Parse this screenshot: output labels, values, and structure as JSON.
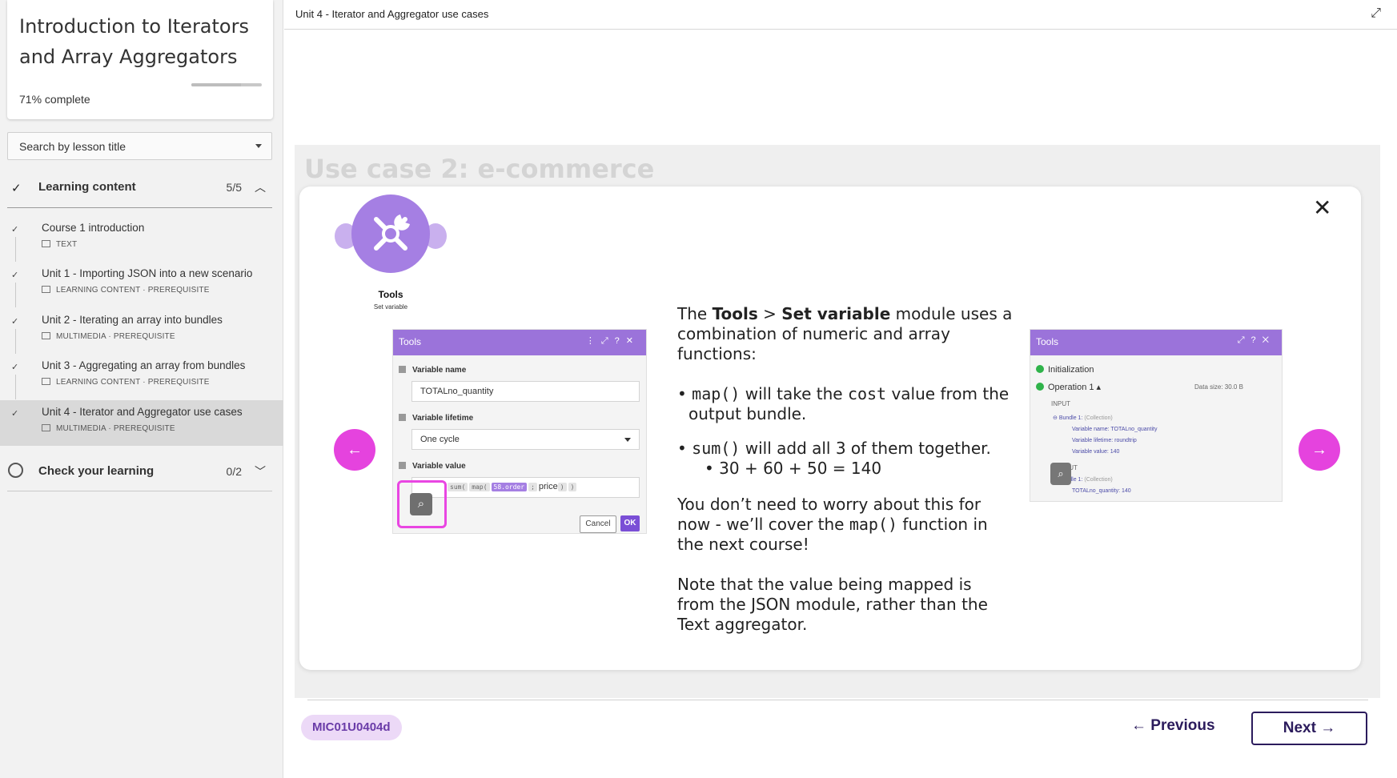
{
  "sidebar": {
    "course_title": "Introduction to Iterators and Array Aggregators",
    "progress_percent": 71,
    "progress_text": "71% complete",
    "search_placeholder": "Search by lesson title",
    "sections": [
      {
        "label": "Learning content",
        "count": "5/5",
        "expanded": true
      },
      {
        "label": "Check your learning",
        "count": "0/2",
        "expanded": false
      }
    ],
    "lessons": [
      {
        "title": "Course 1 introduction",
        "meta": "TEXT"
      },
      {
        "title": "Unit 1 - Importing JSON into a new scenario",
        "meta": "LEARNING CONTENT · PREREQUISITE"
      },
      {
        "title": "Unit 2 - Iterating an array into bundles",
        "meta": "MULTIMEDIA · PREREQUISITE"
      },
      {
        "title": "Unit 3 - Aggregating an array from bundles",
        "meta": "LEARNING CONTENT · PREREQUISITE"
      },
      {
        "title": "Unit 4 - Iterator and Aggregator use cases",
        "meta": "MULTIMEDIA · PREREQUISITE",
        "active": true
      }
    ]
  },
  "topbar": {
    "unit_title": "Unit 4 - Iterator and Aggregator use cases"
  },
  "slide": {
    "heading": "Use case 2: e-commerce",
    "module": {
      "name": "Tools",
      "subtitle": "Set variable"
    },
    "left_dialog": {
      "title": "Tools",
      "field1_label": "Variable name",
      "field1_value": "TOTALno_quantity",
      "field2_label": "Variable lifetime",
      "field2_value": "One cycle",
      "field3_label": "Variable value",
      "formula": {
        "fn1": "sum(",
        "fn2": "map(",
        "ref": "58.order",
        "sep": "; ",
        "key": "price",
        "close1": ")",
        "close2": ")"
      },
      "cancel": "Cancel",
      "ok": "OK"
    },
    "text": {
      "p1_a": "The ",
      "p1_tools": "Tools",
      "p1_gt": " > ",
      "p1_setvar": "Set variable",
      "p1_b": " module uses a combination of numeric and array functions:",
      "b1_code": "map()",
      "b1_a": " will take the ",
      "b1_code2": "cost",
      "b1_b": "  value from the output bundle.",
      "b2_code": "sum()",
      "b2_a": " will add all 3 of them together.",
      "b2_sub": "30 + 60 + 50 = 140",
      "p2_a": "You don’t need to worry about this for now - we’ll cover the ",
      "p2_code": "map()",
      "p2_b": " function in the next course!",
      "p3": "Note that the value being mapped is from the JSON module, rather than the Text aggregator."
    },
    "right_dialog": {
      "title": "Tools",
      "init": "Initialization",
      "op": "Operation 1 ▴",
      "data_size": "Data size: 30.0 B",
      "input": "INPUT",
      "bundle1": "Bundle 1:",
      "collection": "(Collection)",
      "var_name": "Variable name: TOTALno_quantity",
      "var_life": "Variable lifetime: roundtrip",
      "var_value": "Variable value: 140",
      "output": "OUTPUT",
      "out_bundle": "Bundle 1:",
      "out_collection": "(Collection)",
      "out_value": "TOTALno_quantity: 140"
    }
  },
  "footer": {
    "code": "MIC01U0404d",
    "previous": "← Previous",
    "next": "Next →"
  }
}
